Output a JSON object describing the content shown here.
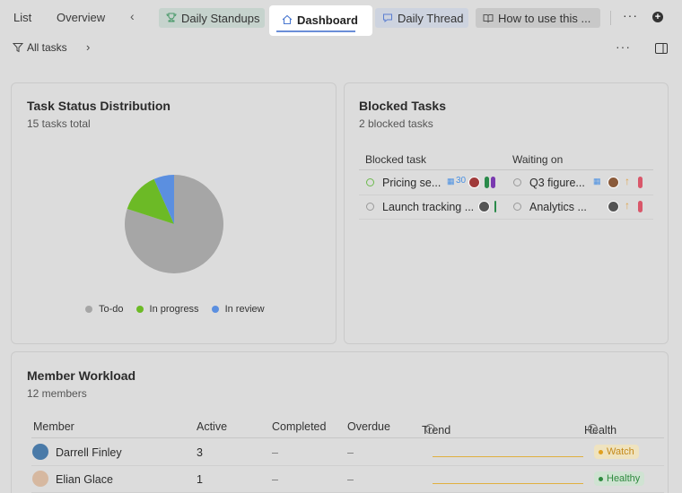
{
  "tabs": {
    "list": "List",
    "overview": "Overview",
    "daily_standups": "Daily Standups",
    "dashboard": "Dashboard",
    "daily_thread": "Daily Thread",
    "how_to": "How to use this ..."
  },
  "filter": {
    "label": "All tasks"
  },
  "status_card": {
    "title": "Task Status Distribution",
    "subtitle": "15 tasks total"
  },
  "chart_data": {
    "type": "pie",
    "categories": [
      "To-do",
      "In progress",
      "In review"
    ],
    "values": [
      12,
      2,
      1
    ],
    "colors": [
      "#a6a6a6",
      "#6cba26",
      "#5b8fe0"
    ],
    "legend_position": "bottom"
  },
  "blocked_card": {
    "title": "Blocked Tasks",
    "subtitle": "2 blocked tasks",
    "col_task": "Blocked task",
    "col_waiting": "Waiting on",
    "rows": [
      {
        "task": "Pricing se...",
        "task_badge": "30",
        "waiting": "Q3 figure..."
      },
      {
        "task": "Launch tracking ...",
        "waiting": "Analytics ..."
      }
    ]
  },
  "workload_card": {
    "title": "Member Workload",
    "subtitle": "12 members",
    "columns": [
      "Member",
      "Active",
      "Completed",
      "Overdue",
      "Trend",
      "Health"
    ],
    "rows": [
      {
        "member": "Darrell Finley",
        "active": "3",
        "completed": "–",
        "overdue": "–",
        "health": "Watch"
      },
      {
        "member": "Elian Glace",
        "active": "1",
        "completed": "–",
        "overdue": "–",
        "health": "Healthy"
      }
    ]
  }
}
